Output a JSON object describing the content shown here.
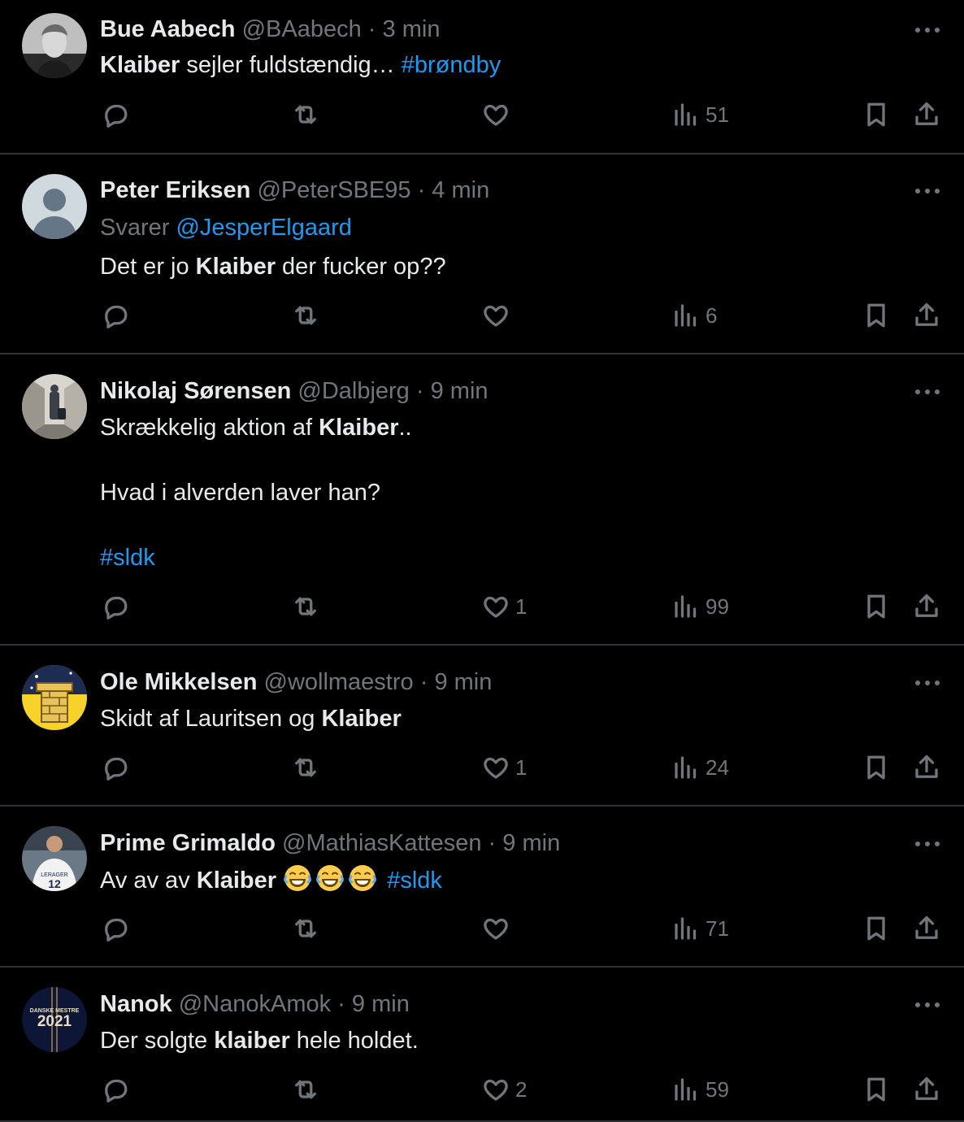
{
  "tweets": [
    {
      "name": "Bue Aabech",
      "handle": "@BAabech",
      "dot": "·",
      "time": "3 min",
      "reply_label": "",
      "reply_handle": "",
      "lines": [
        {
          "pre": "",
          "bold": "Klaiber",
          "post": " sejler fuldstændig… ",
          "tag": "#brøndby"
        }
      ],
      "likes": "",
      "views": "51",
      "avatar": "photo-man-gray-icon"
    },
    {
      "name": "Peter Eriksen",
      "handle": "@PeterSBE95",
      "dot": "·",
      "time": "4 min",
      "reply_label": "Svarer",
      "reply_handle": "@JesperElgaard",
      "lines": [
        {
          "pre": "Det er jo ",
          "bold": "Klaiber",
          "post": " der fucker op??",
          "tag": ""
        }
      ],
      "likes": "",
      "views": "6",
      "avatar": "default-profile-icon"
    },
    {
      "name": "Nikolaj Sørensen",
      "handle": "@Dalbjerg",
      "dot": "·",
      "time": "9 min",
      "reply_label": "",
      "reply_handle": "",
      "lines": [
        {
          "pre": "Skrækkelig aktion af ",
          "bold": "Klaiber",
          "post": "..",
          "tag": ""
        },
        {
          "pre": "Hvad i alverden laver han?",
          "bold": "",
          "post": "",
          "tag": ""
        },
        {
          "pre": "",
          "bold": "",
          "post": "",
          "tag": "#sldk"
        }
      ],
      "likes": "1",
      "views": "99",
      "avatar": "photo-hallway-icon"
    },
    {
      "name": "Ole Mikkelsen",
      "handle": "@wollmaestro",
      "dot": "·",
      "time": "9 min",
      "reply_label": "",
      "reply_handle": "",
      "lines": [
        {
          "pre": "Skidt af Lauritsen og ",
          "bold": "Klaiber",
          "post": "",
          "tag": ""
        }
      ],
      "likes": "1",
      "views": "24",
      "avatar": "yellow-tower-icon"
    },
    {
      "name": "Prime Grimaldo",
      "handle": "@MathiasKattesen",
      "dot": "·",
      "time": "9 min",
      "reply_label": "",
      "reply_handle": "",
      "lines": [
        {
          "pre": "Av av av ",
          "bold": "Klaiber",
          "post": " 😂😂😂 ",
          "tag": "#sldk",
          "emoji": true
        }
      ],
      "likes": "",
      "views": "71",
      "avatar": "photo-player-12-icon"
    },
    {
      "name": "Nanok",
      "handle": "@NanokAmok",
      "dot": "·",
      "time": "9 min",
      "reply_label": "",
      "reply_handle": "",
      "lines": [
        {
          "pre": "Der solgte ",
          "bold": "klaiber",
          "post": " hele holdet.",
          "tag": ""
        }
      ],
      "likes": "2",
      "views": "59",
      "avatar": "danske-mestre-2021-badge"
    }
  ],
  "badge": {
    "top": "DANSKE MESTRE",
    "year": "2021"
  },
  "colors": {
    "background": "#000000",
    "text": "#e7e9ea",
    "muted": "#71767b",
    "link": "#1d9bf0",
    "divider": "#2f3336"
  }
}
